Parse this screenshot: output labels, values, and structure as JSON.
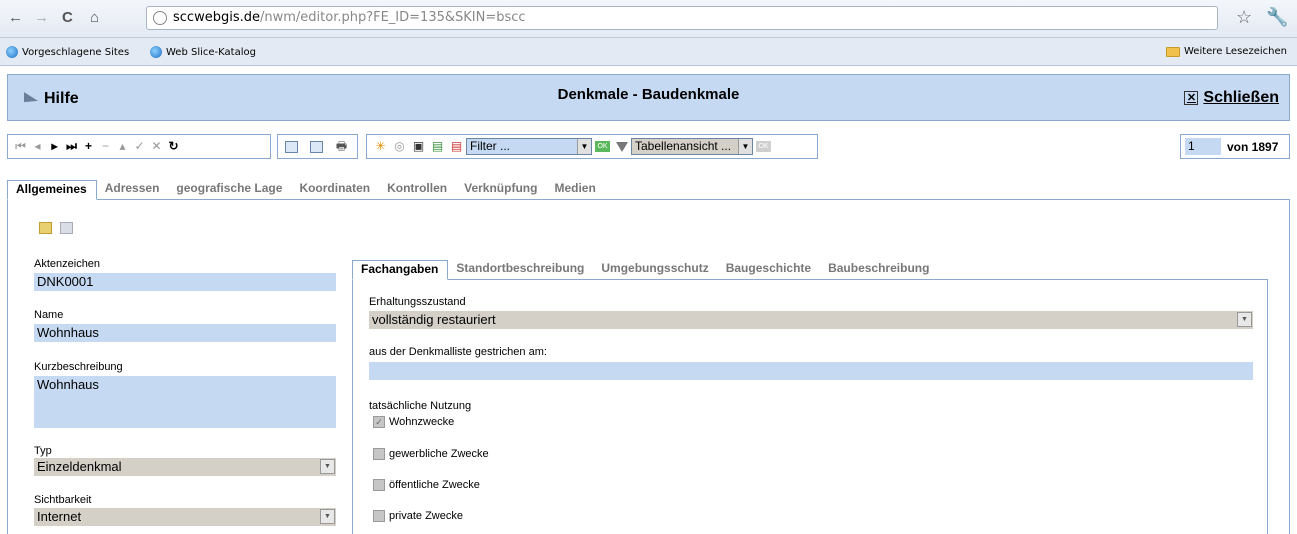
{
  "browser": {
    "url_host": "sccwebgis.de",
    "url_path": "/nwm/editor.php?FE_ID=135&SKIN=bscc",
    "bookmarks": [
      "Vorgeschlagene Sites",
      "Web Slice-Katalog"
    ],
    "other_bookmarks": "Weitere Lesezeichen"
  },
  "header": {
    "help_label": "Hilfe",
    "title": "Denkmale - Baudenkmale",
    "close_label": "Schließen"
  },
  "toolbar": {
    "filter_value": "Filter ...",
    "view_value": "Tabellenansicht ...",
    "ok_label": "OK"
  },
  "pager": {
    "current": "1",
    "of_label": "von 1897"
  },
  "tabs": [
    "Allgemeines",
    "Adressen",
    "geografische Lage",
    "Koordinaten",
    "Kontrollen",
    "Verknüpfung",
    "Medien"
  ],
  "form": {
    "aktenzeichen_label": "Aktenzeichen",
    "aktenzeichen_value": "DNK0001",
    "name_label": "Name",
    "name_value": "Wohnhaus",
    "kurz_label": "Kurzbeschreibung",
    "kurz_value": "Wohnhaus",
    "typ_label": "Typ",
    "typ_value": "Einzeldenkmal",
    "sicht_label": "Sichtbarkeit",
    "sicht_value": "Internet"
  },
  "inner_tabs": [
    "Fachangaben",
    "Standortbeschreibung",
    "Umgebungsschutz",
    "Baugeschichte",
    "Baubeschreibung"
  ],
  "fach": {
    "erhaltung_label": "Erhaltungsszustand",
    "erhaltung_value": "vollständig restauriert",
    "gestrichen_label": "aus der Denkmalliste gestrichen am:",
    "gestrichen_value": "",
    "nutzung_label": "tatsächliche Nutzung",
    "nutzungen": [
      {
        "label": "Wohnzwecke",
        "checked": true
      },
      {
        "label": "gewerbliche Zwecke",
        "checked": false
      },
      {
        "label": "öffentliche Zwecke",
        "checked": false
      },
      {
        "label": "private Zwecke",
        "checked": false
      }
    ]
  }
}
